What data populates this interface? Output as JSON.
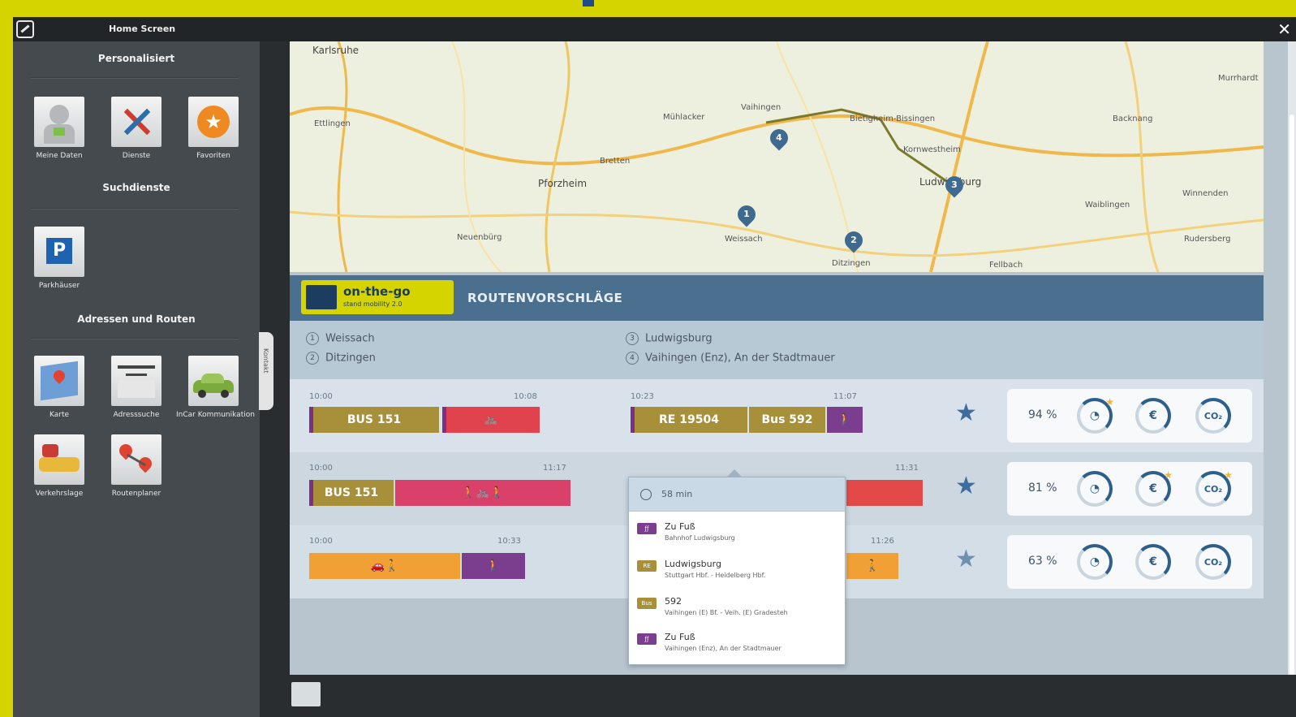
{
  "window": {
    "title": "Home Screen",
    "close_label": "✕"
  },
  "sidebar": {
    "sections": [
      {
        "title": "Personalisiert",
        "tiles": [
          {
            "label": "Meine Daten",
            "icon": "user-profile-icon"
          },
          {
            "label": "Dienste",
            "icon": "tools-icon"
          },
          {
            "label": "Favoriten",
            "icon": "star-favorite-icon"
          }
        ]
      },
      {
        "title": "Suchdienste",
        "tiles": [
          {
            "label": "Parkhäuser",
            "icon": "parking-icon",
            "glyph": "P"
          }
        ]
      },
      {
        "title": "Adressen und Routen",
        "tiles": [
          {
            "label": "Karte",
            "icon": "map-icon"
          },
          {
            "label": "Adresssuche",
            "icon": "address-search-icon"
          },
          {
            "label": "InCar Kommunikation",
            "icon": "car-communication-icon"
          },
          {
            "label": "Verkehrslage",
            "icon": "traffic-icon"
          },
          {
            "label": "Routenplaner",
            "icon": "route-planner-icon"
          }
        ]
      }
    ],
    "handle_label": "Kontakt"
  },
  "map": {
    "places": [
      "Karlsruhe",
      "Ettlingen",
      "Pforzheim",
      "Weissach",
      "Ditzingen",
      "Ludwigsburg",
      "Bietigheim-Bissingen",
      "Backnang",
      "Mühlacker",
      "Vaihingen",
      "Neuenbürg",
      "Waiblingen",
      "Fellbach",
      "Bretten",
      "Kornwestheim",
      "Murrhardt",
      "Winnenden",
      "Rudersberg"
    ],
    "markers": [
      "1",
      "2",
      "3",
      "4"
    ]
  },
  "header": {
    "logo_title": "on-the-go",
    "logo_subtitle": "stand mobility 2.0",
    "title": "ROUTENVORSCHLÄGE"
  },
  "stops": [
    {
      "n": "1",
      "name": "Weissach"
    },
    {
      "n": "2",
      "name": "Ditzingen"
    },
    {
      "n": "3",
      "name": "Ludwigsburg"
    },
    {
      "n": "4",
      "name": "Vaihingen (Enz), An der Stadtmauer"
    }
  ],
  "routes": [
    {
      "left": {
        "start": "10:00",
        "end": "10:08",
        "segments": [
          "BUS 151",
          "🚲"
        ]
      },
      "right": {
        "start": "10:23",
        "end": "11:07",
        "segments": [
          "RE 19504",
          "Bus 592",
          "🚶"
        ]
      },
      "percent": "94 %",
      "favorite": true
    },
    {
      "left": {
        "start": "10:00",
        "end": "11:17",
        "segments": [
          "BUS 151",
          "🚶🚲🚶"
        ]
      },
      "right": {
        "start": "",
        "end": "11:31",
        "segments": [
          ""
        ]
      },
      "percent": "81 %",
      "favorite": true
    },
    {
      "left": {
        "start": "10:00",
        "end": "10:33",
        "segments": [
          "🚗🚶",
          "🚶"
        ]
      },
      "right": {
        "start": "",
        "end": "11:26",
        "segments": [
          "🚶"
        ]
      },
      "percent": "63 %",
      "favorite": false
    }
  ],
  "metric_labels": {
    "time": "◔",
    "cost": "€",
    "co2": "CO₂"
  },
  "popup": {
    "duration": "58 min",
    "legs": [
      {
        "icon_text": "ƒƒ",
        "title": "Zu Fuß",
        "sub": "Bahnhof Ludwigsburg",
        "color": "#7b3e8f"
      },
      {
        "icon_text": "RE",
        "title": "Ludwigsburg",
        "sub": "Stuttgart Hbf. - Heidelberg Hbf.",
        "color": "#a8903a"
      },
      {
        "icon_text": "Bus",
        "title": "592",
        "sub": "Vaihingen (E) Bf. - Veih. (E) Gradesteh",
        "color": "#a8903a"
      },
      {
        "icon_text": "ƒƒ",
        "title": "Zu Fuß",
        "sub": "Vaihingen (Enz), An der Stadtmauer",
        "color": "#7b3e8f"
      }
    ]
  },
  "colors": {
    "frame": "#d6d400",
    "sidebar": "#454a4f",
    "header": "#4b6f8e",
    "accent_blue": "#2e5f8c",
    "star": "#3c6d9e"
  }
}
